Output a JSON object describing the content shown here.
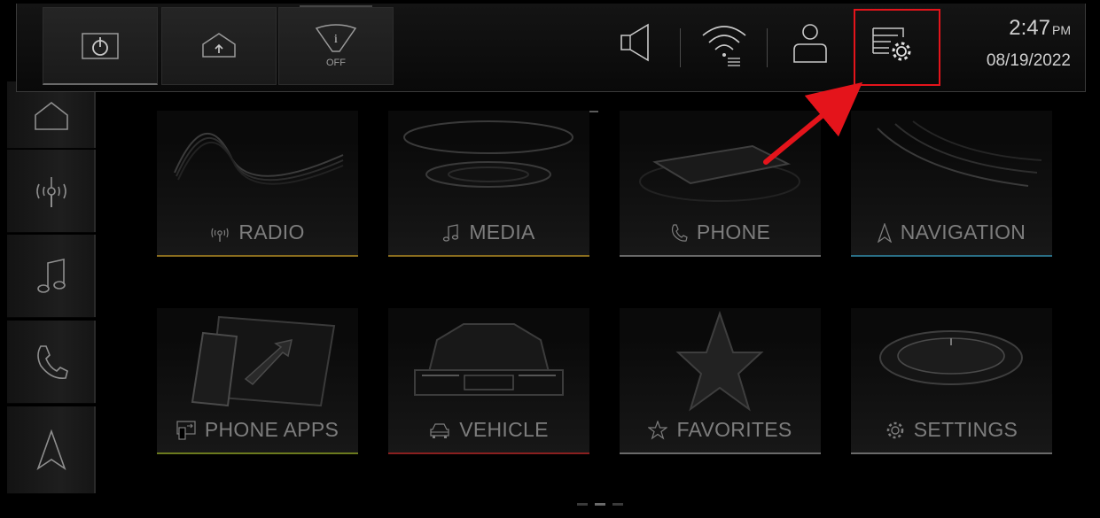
{
  "status_bar": {
    "time": "2:47",
    "ampm": "PM",
    "date": "08/19/2022",
    "hazard_off_label": "OFF"
  },
  "quick_buttons": [
    "power-icon",
    "home-up-icon",
    "wiper-info-off-icon"
  ],
  "status_icons": [
    "volume-icon",
    "wifi-icon",
    "user-profile-icon",
    "settings-menu-icon"
  ],
  "side_rail": [
    "home-icon",
    "radio-antenna-icon",
    "music-note-icon",
    "phone-icon",
    "navigation-arrow-icon"
  ],
  "tiles": [
    {
      "label": "RADIO",
      "icon": "radio-antenna-icon",
      "accent": "#8a6d1e"
    },
    {
      "label": "MEDIA",
      "icon": "music-note-icon",
      "accent": "#8a6d1e"
    },
    {
      "label": "PHONE",
      "icon": "phone-icon",
      "accent": "#6a6a6a"
    },
    {
      "label": "NAVIGATION",
      "icon": "navigation-arrow-icon",
      "accent": "#2a6f86"
    },
    {
      "label": "PHONE APPS",
      "icon": "phone-apps-icon",
      "accent": "#6b7a1e"
    },
    {
      "label": "VEHICLE",
      "icon": "car-icon",
      "accent": "#8a1f1f"
    },
    {
      "label": "FAVORITES",
      "icon": "star-icon",
      "accent": "#6a6a6a"
    },
    {
      "label": "SETTINGS",
      "icon": "gear-icon",
      "accent": "#6a6a6a"
    }
  ],
  "highlight_color": "#e4141b"
}
